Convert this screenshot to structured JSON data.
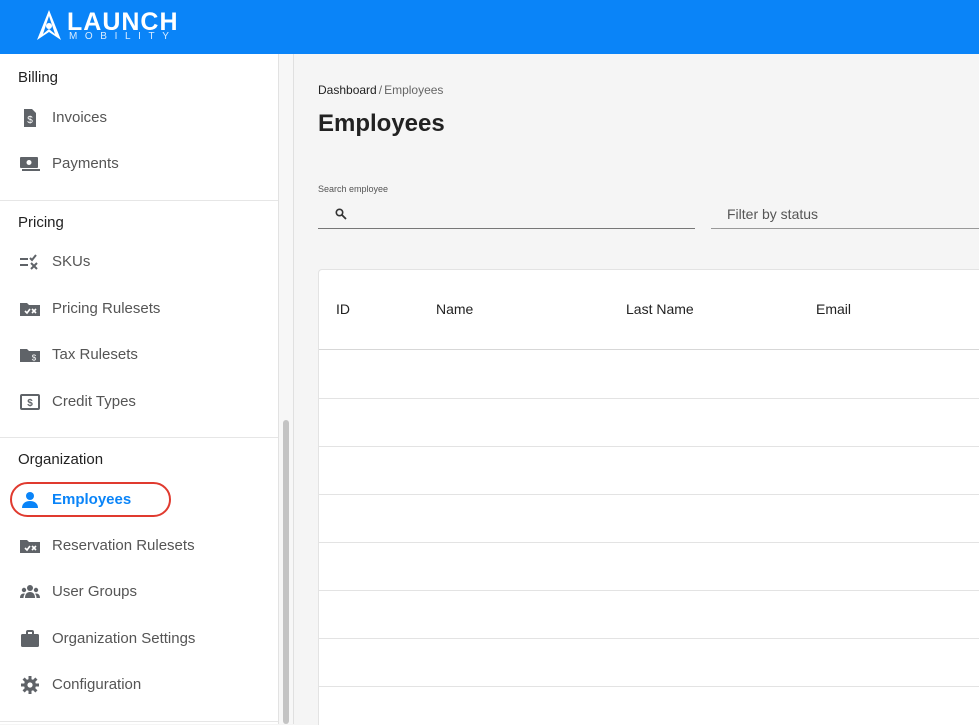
{
  "header": {
    "logo_main": "LAUNCH",
    "logo_sub": "MOBILITY",
    "brand_color": "#0a84f8"
  },
  "sidebar": {
    "sections": [
      {
        "title": "Billing",
        "items": [
          {
            "label": "Invoices",
            "icon": "invoice-icon"
          },
          {
            "label": "Payments",
            "icon": "payments-icon"
          }
        ]
      },
      {
        "title": "Pricing",
        "items": [
          {
            "label": "SKUs",
            "icon": "sku-list-icon"
          },
          {
            "label": "Pricing Rulesets",
            "icon": "ruleset-folder-icon"
          },
          {
            "label": "Tax Rulesets",
            "icon": "tax-folder-icon"
          },
          {
            "label": "Credit Types",
            "icon": "credit-icon"
          }
        ]
      },
      {
        "title": "Organization",
        "items": [
          {
            "label": "Employees",
            "icon": "person-icon",
            "active": true
          },
          {
            "label": "Reservation Rulesets",
            "icon": "ruleset-folder-icon"
          },
          {
            "label": "User Groups",
            "icon": "group-icon"
          },
          {
            "label": "Organization Settings",
            "icon": "briefcase-icon"
          },
          {
            "label": "Configuration",
            "icon": "gear-icon"
          }
        ]
      }
    ],
    "active_color": "#0a84f8",
    "highlight_color": "#e03a2f"
  },
  "main": {
    "breadcrumb": {
      "root": "Dashboard",
      "separator": "/",
      "current": "Employees"
    },
    "title": "Employees",
    "search": {
      "label": "Search employee",
      "value": "",
      "placeholder": ""
    },
    "filter": {
      "placeholder": "Filter by status"
    },
    "table": {
      "columns": [
        "ID",
        "Name",
        "Last Name",
        "Email"
      ],
      "rows": []
    }
  }
}
